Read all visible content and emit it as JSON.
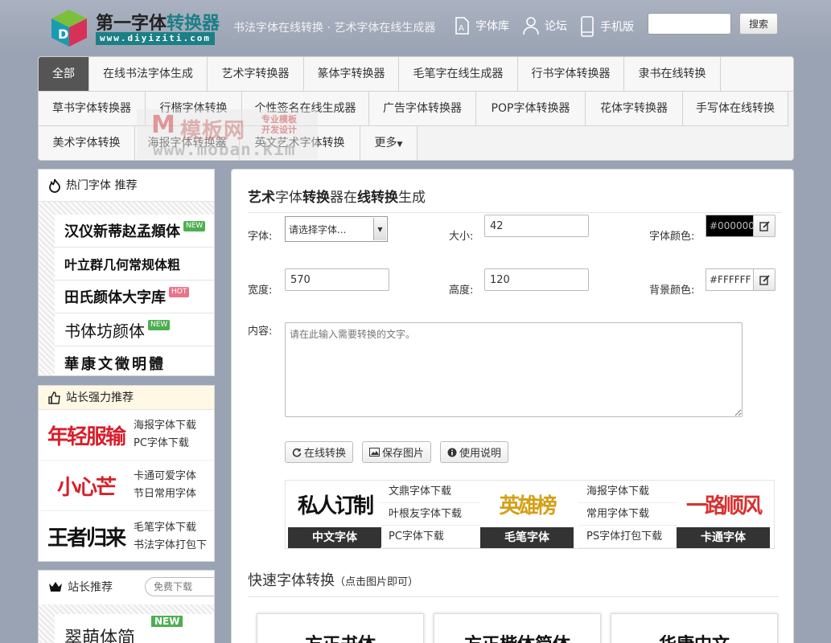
{
  "header": {
    "logo_title_a": "第一字体",
    "logo_title_b": "转换器",
    "logo_url": "www.diyiziti.com",
    "slogan": "书法字体在线转换 · 艺术字体在线生成器",
    "nav": [
      {
        "label": "字体库",
        "icon": "font-library-icon"
      },
      {
        "label": "论坛",
        "icon": "user-icon"
      },
      {
        "label": "手机版",
        "icon": "mobile-icon"
      }
    ],
    "search_placeholder": "",
    "search_label": "搜索"
  },
  "catnav": {
    "items": [
      {
        "label": "全部",
        "active": true
      },
      {
        "label": "在线书法字体生成"
      },
      {
        "label": "艺术字转换器"
      },
      {
        "label": "篆体字转换器"
      },
      {
        "label": "毛笔字在线生成器"
      },
      {
        "label": "行书字体转换器"
      },
      {
        "label": "隶书在线转换"
      },
      {
        "label": "草书字体转换器"
      },
      {
        "label": "行楷字体转换"
      },
      {
        "label": "个性签名在线生成器"
      },
      {
        "label": "广告字体转换器"
      },
      {
        "label": "POP字体转换器"
      },
      {
        "label": "花体字转换器"
      },
      {
        "label": "手写体在线转换"
      },
      {
        "label": "美术字体转换"
      },
      {
        "label": "海报字体转换器"
      },
      {
        "label": "英文艺术字体转换"
      },
      {
        "label": "更多"
      }
    ],
    "watermark": {
      "m": "M",
      "text": "模板网",
      "sub1": "专业模板",
      "sub2": "开发设计",
      "url": "www.moban.kim"
    }
  },
  "sidebar": {
    "hot": {
      "title": "热门字体  推荐",
      "fonts": [
        {
          "name": "汉仪新蒂赵孟頫体",
          "tag": "NEW"
        },
        {
          "name": "叶立群几何常规体粗",
          "tag": ""
        },
        {
          "name": "田氏颜体大字库",
          "tag": "HOT"
        },
        {
          "name": "书体坊颜体",
          "tag": "NEW"
        },
        {
          "name": "華康文徵明體",
          "tag": ""
        }
      ]
    },
    "recommend": {
      "title": "站长强力推荐",
      "rows": [
        {
          "art": "年轻服输",
          "links": [
            "海报字体下载",
            "PC字体下载"
          ],
          "color": "#d81e2a"
        },
        {
          "art": "小心芒",
          "links": [
            "卡通可爱字体",
            "节日常用字体"
          ],
          "color": "#d81e2a"
        },
        {
          "art": "王者归来",
          "links": [
            "毛笔字体下载",
            "书法字体打包下"
          ],
          "color": "#111111"
        }
      ]
    },
    "site": {
      "title": "站长推荐",
      "search_placeholder": "免费下载",
      "font": "翠萌体简",
      "tag": "NEW"
    }
  },
  "main": {
    "title": [
      {
        "text": "艺术",
        "bold": true
      },
      {
        "text": "字体",
        "bold": false
      },
      {
        "text": "转换",
        "bold": true
      },
      {
        "text": "器在",
        "bold": false
      },
      {
        "text": "线转换",
        "bold": true
      },
      {
        "text": "生成",
        "bold": false
      }
    ],
    "form": {
      "font_label": "字体:",
      "font_value": "请选择字体...",
      "size_label": "大小:",
      "size_value": "42",
      "color_label": "字体颜色:",
      "color_value": "#000000",
      "width_label": "宽度:",
      "width_value": "570",
      "height_label": "高度:",
      "height_value": "120",
      "bg_label": "背景颜色:",
      "bg_value": "#FFFFFF",
      "content_label": "内容:",
      "content_placeholder": "请在此输入需要转换的文字。"
    },
    "actions": [
      {
        "label": "在线转换",
        "icon": "refresh-icon"
      },
      {
        "label": "保存图片",
        "icon": "image-icon"
      },
      {
        "label": "使用说明",
        "icon": "info-icon"
      }
    ],
    "showcase": {
      "cards": [
        {
          "art": "私人订制",
          "caption": "中文字体",
          "color": "#111111"
        },
        {
          "art": "英雄榜",
          "caption": "毛笔字体",
          "color": "#d4a017"
        },
        {
          "art": "一路顺风",
          "caption": "卡通字体",
          "color": "#d8312f"
        }
      ],
      "links": [
        [
          "文鼎字体下载",
          "叶根友字体下载",
          "PC字体下载"
        ],
        [
          "海报字体下载",
          "常用字体下载",
          "PS字体打包下载"
        ]
      ]
    },
    "quick": {
      "title": "快速字体转换",
      "hint": "（点击图片即可）",
      "cards": [
        "方正书体",
        "方正楷体简体",
        "华康中文"
      ]
    }
  }
}
